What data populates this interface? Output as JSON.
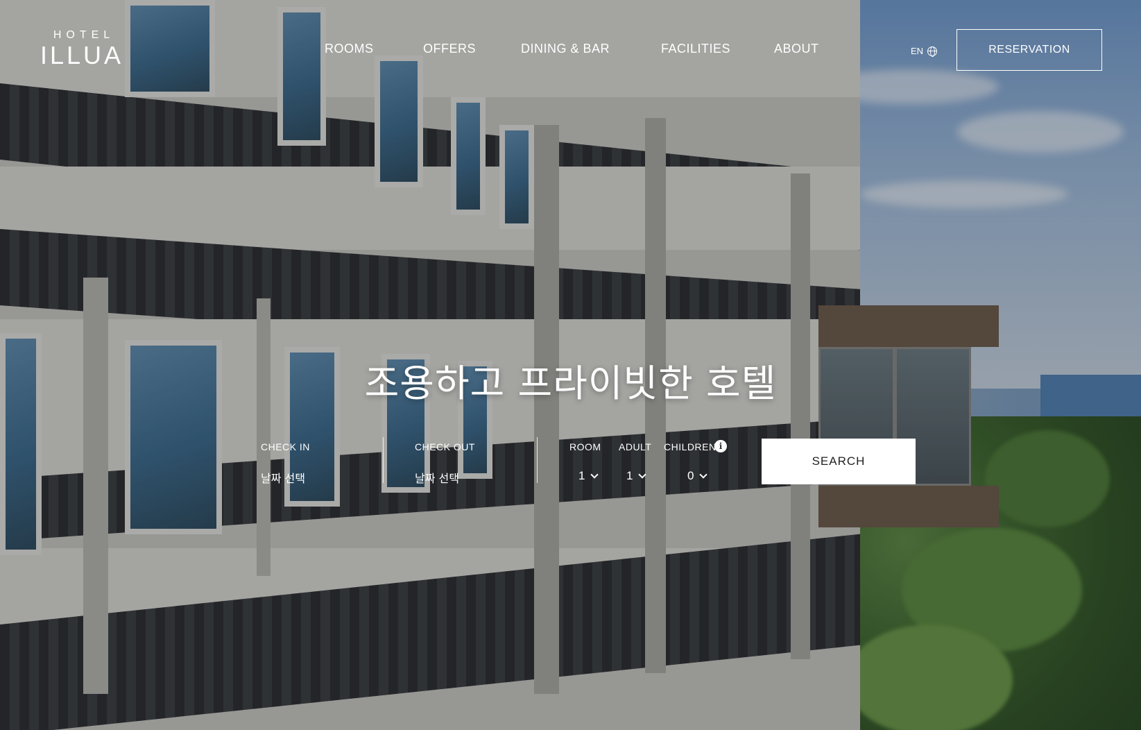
{
  "header": {
    "logo_small": "HOTEL",
    "logo_big": "ILLUA",
    "nav": [
      {
        "label": "ROOMS"
      },
      {
        "label": "OFFERS"
      },
      {
        "label": "DINING & BAR"
      },
      {
        "label": "FACILITIES"
      },
      {
        "label": "ABOUT"
      }
    ],
    "language": "EN",
    "reservation_label": "RESERVATION"
  },
  "hero": {
    "title": "조용하고 프라이빗한 호텔"
  },
  "booking": {
    "check_in_label": "CHECK IN",
    "check_in_value": "날짜 선택",
    "check_out_label": "CHECK OUT",
    "check_out_value": "날짜 선택",
    "room_label": "ROOM",
    "room_value": "1",
    "adult_label": "ADULT",
    "adult_value": "1",
    "children_label": "CHILDREN",
    "children_value": "0",
    "info_glyph": "i",
    "search_label": "SEARCH"
  },
  "icons": {
    "language": "globe-icon",
    "children_info": "info-icon",
    "selects": "chevron-down-icon"
  },
  "colors": {
    "text": "#ffffff",
    "search_button_bg": "#ffffff",
    "search_button_text": "#222222"
  }
}
